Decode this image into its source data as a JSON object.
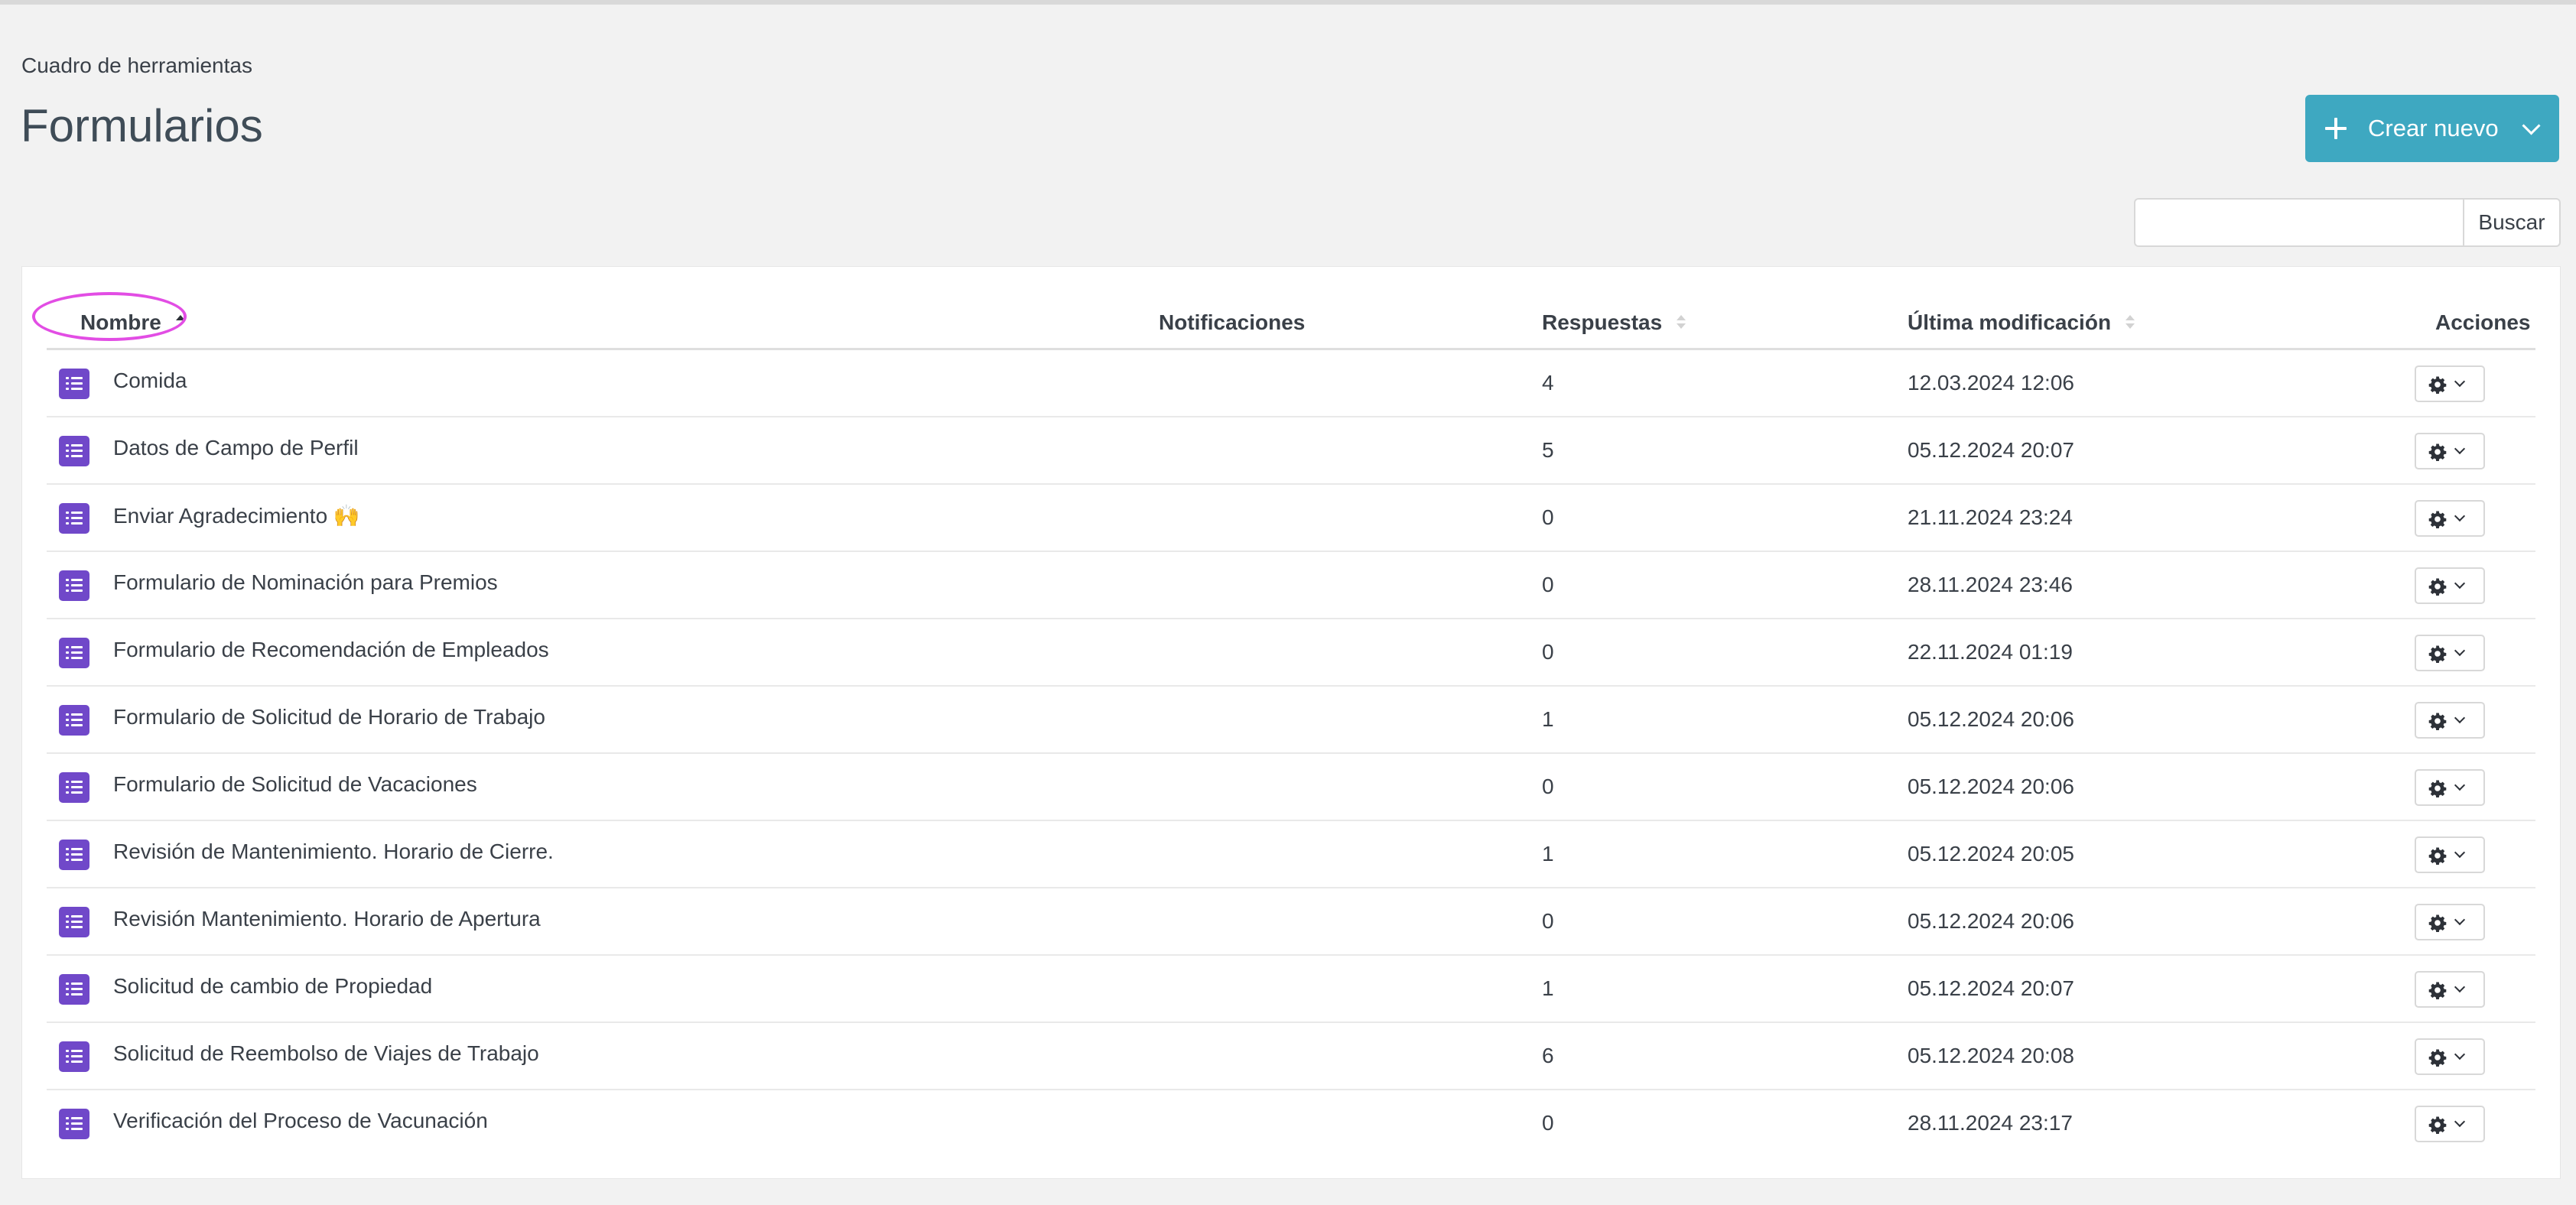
{
  "breadcrumb": "Cuadro de herramientas",
  "page_title": "Formularios",
  "create_button": {
    "label": "Crear nuevo",
    "icon": "plus-icon",
    "dropdown_icon": "chevron-down-icon"
  },
  "search": {
    "value": "",
    "placeholder": "",
    "button_label": "Buscar"
  },
  "table": {
    "columns": {
      "name": "Nombre",
      "notifications": "Notificaciones",
      "responses": "Respuestas",
      "modified": "Última modificación",
      "actions": "Acciones"
    },
    "sorted_by": "Nombre",
    "sort_direction": "ascending",
    "rows": [
      {
        "name": "Comida",
        "responses": "4",
        "modified": "12.03.2024 12:06"
      },
      {
        "name": "Datos de Campo de Perfil",
        "responses": "5",
        "modified": "05.12.2024 20:07"
      },
      {
        "name": "Enviar Agradecimiento 🙌",
        "responses": "0",
        "modified": "21.11.2024 23:24"
      },
      {
        "name": "Formulario de Nominación para Premios",
        "responses": "0",
        "modified": "28.11.2024 23:46"
      },
      {
        "name": "Formulario de Recomendación de Empleados",
        "responses": "0",
        "modified": "22.11.2024 01:19"
      },
      {
        "name": "Formulario de Solicitud de Horario de Trabajo",
        "responses": "1",
        "modified": "05.12.2024 20:06"
      },
      {
        "name": "Formulario de Solicitud de Vacaciones",
        "responses": "0",
        "modified": "05.12.2024 20:06"
      },
      {
        "name": "Revisión de Mantenimiento. Horario de Cierre.",
        "responses": "1",
        "modified": "05.12.2024 20:05"
      },
      {
        "name": "Revisión Mantenimiento. Horario de Apertura",
        "responses": "0",
        "modified": "05.12.2024 20:06"
      },
      {
        "name": "Solicitud de cambio de Propiedad",
        "responses": "1",
        "modified": "05.12.2024 20:07"
      },
      {
        "name": "Solicitud de Reembolso de Viajes de Trabajo",
        "responses": "6",
        "modified": "05.12.2024 20:08"
      },
      {
        "name": "Verificación del Proceso de Vacunación",
        "responses": "0",
        "modified": "28.11.2024 23:17"
      }
    ]
  },
  "icons": {
    "row_icon": "form-list-icon",
    "action_icon": "gear-icon",
    "action_dropdown": "chevron-down-icon"
  },
  "colors": {
    "accent": "#3ea8c1",
    "form_icon": "#7048c9",
    "highlight_ring": "#e24de4",
    "background": "#f2f2f2"
  }
}
